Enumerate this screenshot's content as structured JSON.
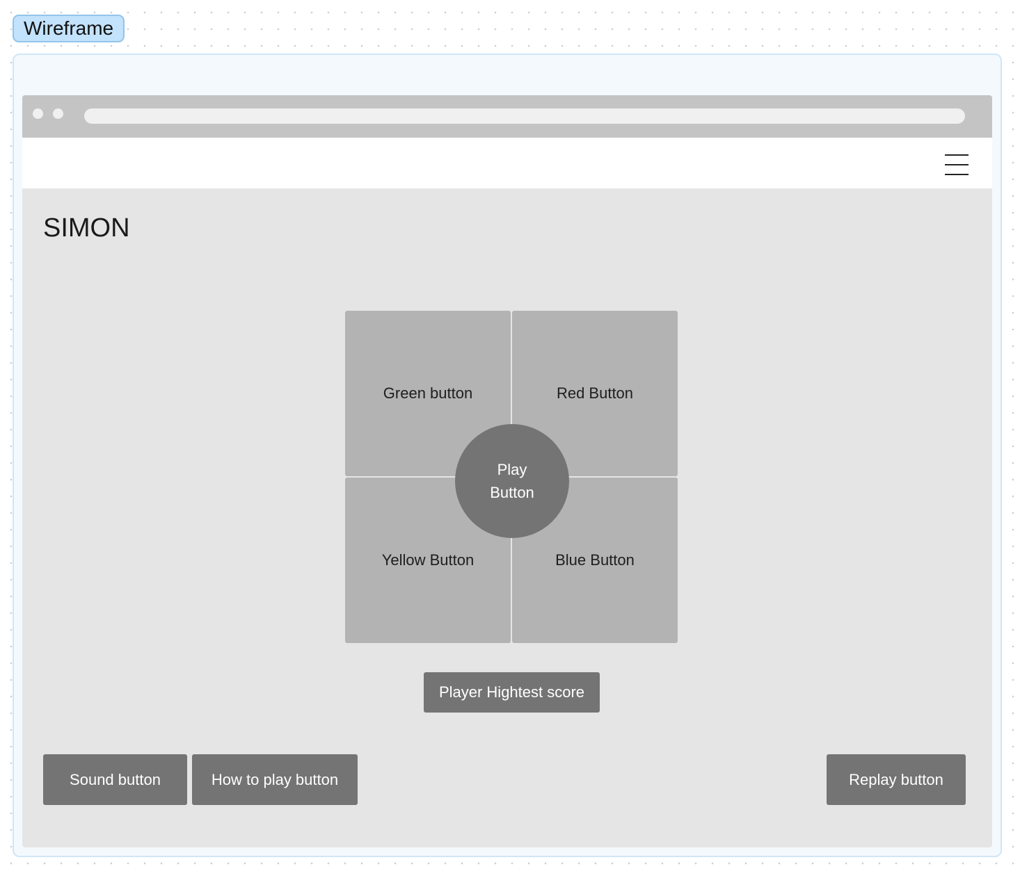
{
  "canvas": {
    "frame_label": "Wireframe"
  },
  "page": {
    "title": "SIMON"
  },
  "game": {
    "green_label": "Green button",
    "red_label": "Red Button",
    "yellow_label": "Yellow Button",
    "blue_label": "Blue Button",
    "play_label": "Play Button"
  },
  "score": {
    "label": "Player Hightest score"
  },
  "footer": {
    "sound_label": "Sound button",
    "how_to_play_label": "How to play button",
    "replay_label": "Replay button"
  },
  "icons": {
    "menu": "hamburger-menu-icon"
  },
  "colors": {
    "frame_tag_bg": "#c3e2fb",
    "page_bg": "#e5e5e5",
    "quad_fill": "#b3b3b3",
    "dark_button": "#747474"
  }
}
